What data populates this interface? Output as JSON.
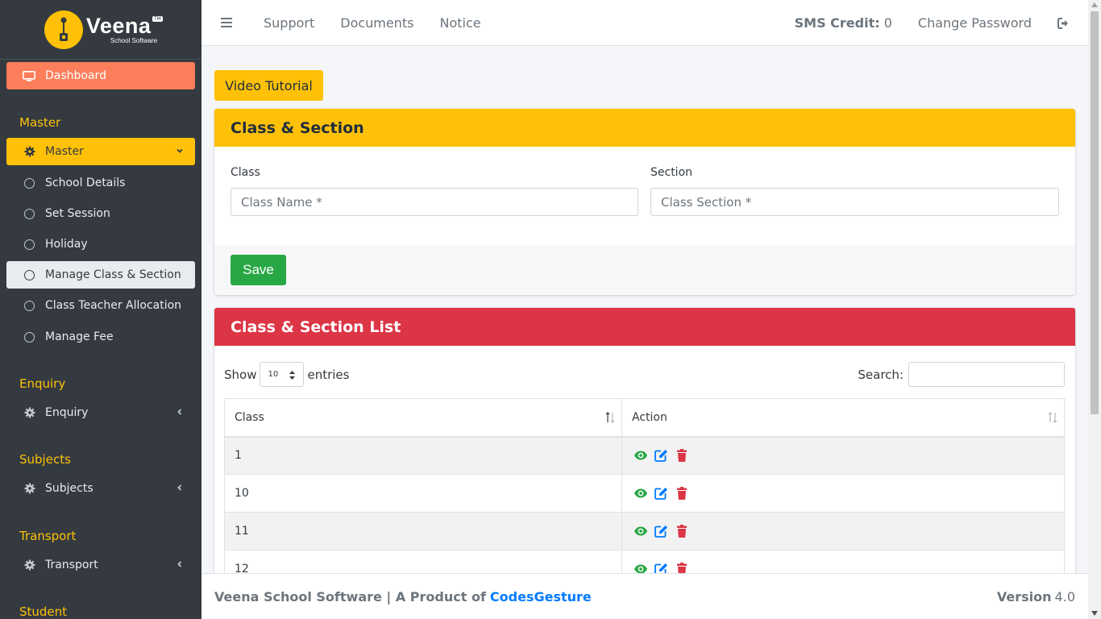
{
  "brand": {
    "name": "Veena",
    "subtitle": "School Software",
    "tag": "TM"
  },
  "sidebar": {
    "dashboard": "Dashboard",
    "sections": [
      {
        "header": "Master"
      },
      {
        "header": "Enquiry"
      },
      {
        "header": "Subjects"
      },
      {
        "header": "Transport"
      },
      {
        "header": "Student"
      }
    ],
    "master_group": "Master",
    "master_items": [
      "School Details",
      "Set Session",
      "Holiday",
      "Manage Class & Section",
      "Class Teacher Allocation",
      "Manage Fee"
    ],
    "enquiry_group": "Enquiry",
    "subjects_group": "Subjects",
    "transport_group": "Transport"
  },
  "topbar": {
    "links": [
      "Support",
      "Documents",
      "Notice"
    ],
    "sms_label": "SMS Credit:",
    "sms_value": "0",
    "change_password": "Change Password"
  },
  "main": {
    "video_tutorial": "Video Tutorial",
    "form_card": {
      "title": "Class & Section",
      "class_label": "Class",
      "class_placeholder": "Class Name *",
      "section_label": "Section",
      "section_placeholder": "Class Section *",
      "save": "Save"
    },
    "list_card": {
      "title": "Class & Section List",
      "show": "Show",
      "entries_value": "10",
      "entries": "entries",
      "search_label": "Search:",
      "columns": [
        "Class",
        "Action"
      ],
      "rows": [
        "1",
        "10",
        "11",
        "12"
      ]
    }
  },
  "footer": {
    "text": "Veena School Software | A Product of",
    "link": "CodesGesture",
    "version_label": "Version",
    "version_value": "4.0"
  },
  "colors": {
    "accent_yellow": "#ffc107",
    "dashboard_orange": "#fd7e5a",
    "danger_red": "#dc3545",
    "success_green": "#28a745",
    "sidebar_dark": "#343a40"
  }
}
